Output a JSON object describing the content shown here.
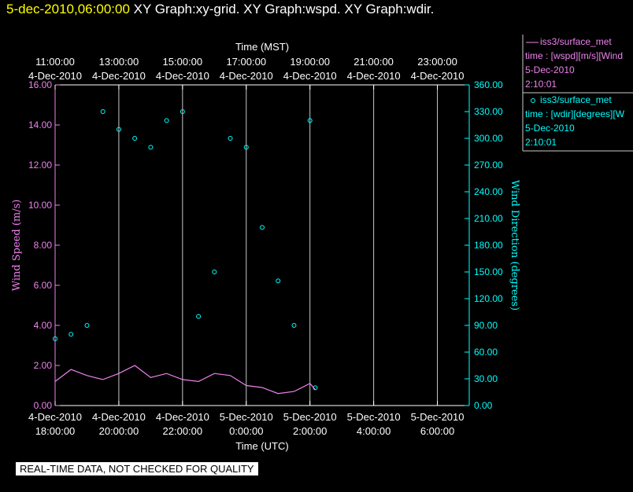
{
  "title": {
    "date": "5-dec-2010,06:00:00",
    "graphs": "XY Graph:xy-grid.  XY Graph:wspd.  XY Graph:wdir."
  },
  "legend": [
    {
      "line_label": "iss3/surface_met",
      "variable": "time : [wspd][m/s][Wind",
      "date": "5-Dec-2010",
      "time": "2:10:01",
      "color": "#ee82ee",
      "marker": "line"
    },
    {
      "line_label": "iss3/surface_met",
      "variable": "time : [wdir][degrees][W",
      "date": "5-Dec-2010",
      "time": "2:10:01",
      "color": "#00ffff",
      "marker": "circle"
    }
  ],
  "qc_banner": "REAL-TIME DATA, NOT CHECKED FOR QUALITY",
  "colors": {
    "background": "#000000",
    "axis": "#ffffff",
    "wind_speed": "#ee82ee",
    "wind_direction": "#00ffff",
    "title_date": "#ffff00"
  },
  "chart_data": {
    "type": "scatter",
    "top_axis": {
      "label": "Time (MST)",
      "ticks": [
        {
          "time": "11:00:00",
          "date": "4-Dec-2010"
        },
        {
          "time": "13:00:00",
          "date": "4-Dec-2010"
        },
        {
          "time": "15:00:00",
          "date": "4-Dec-2010"
        },
        {
          "time": "17:00:00",
          "date": "4-Dec-2010"
        },
        {
          "time": "19:00:00",
          "date": "4-Dec-2010"
        },
        {
          "time": "21:00:00",
          "date": "4-Dec-2010"
        },
        {
          "time": "23:00:00",
          "date": "4-Dec-2010"
        }
      ]
    },
    "bottom_axis": {
      "label": "Time (UTC)",
      "ticks": [
        {
          "date": "4-Dec-2010",
          "time": "18:00:00"
        },
        {
          "date": "4-Dec-2010",
          "time": "20:00:00"
        },
        {
          "date": "4-Dec-2010",
          "time": "22:00:00"
        },
        {
          "date": "5-Dec-2010",
          "time": "0:00:00"
        },
        {
          "date": "5-Dec-2010",
          "time": "2:00:00"
        },
        {
          "date": "5-Dec-2010",
          "time": "4:00:00"
        },
        {
          "date": "5-Dec-2010",
          "time": "6:00:00"
        }
      ],
      "range_hours_utc": [
        "2010-12-04 18:00",
        "2010-12-05 07:00"
      ]
    },
    "left_axis": {
      "label": "Wind Speed (m/s)",
      "range": [
        0,
        16
      ],
      "ticks": [
        "0.00",
        "2.00",
        "4.00",
        "6.00",
        "8.00",
        "10.00",
        "12.00",
        "14.00",
        "16.00"
      ]
    },
    "right_axis": {
      "label": "Wind Direction (degrees)",
      "range": [
        0,
        360
      ],
      "ticks": [
        "0.00",
        "30.00",
        "60.00",
        "90.00",
        "120.00",
        "150.00",
        "180.00",
        "210.00",
        "240.00",
        "270.00",
        "300.00",
        "330.00",
        "360.00"
      ]
    },
    "grid": "vertical",
    "series": [
      {
        "name": "iss3/surface_met wspd",
        "axis": "left",
        "style": "line",
        "x_utc": [
          "2010-12-04 18:00",
          "2010-12-04 18:30",
          "2010-12-04 19:00",
          "2010-12-04 19:30",
          "2010-12-04 20:00",
          "2010-12-04 20:30",
          "2010-12-04 21:00",
          "2010-12-04 21:30",
          "2010-12-04 22:00",
          "2010-12-04 22:30",
          "2010-12-04 23:00",
          "2010-12-04 23:30",
          "2010-12-05 00:00",
          "2010-12-05 00:30",
          "2010-12-05 01:00",
          "2010-12-05 01:30",
          "2010-12-05 02:00",
          "2010-12-05 02:10"
        ],
        "y": [
          1.2,
          1.8,
          1.5,
          1.3,
          1.6,
          2.0,
          1.4,
          1.6,
          1.3,
          1.2,
          1.6,
          1.5,
          1.0,
          0.9,
          0.6,
          0.7,
          1.1,
          0.8
        ]
      },
      {
        "name": "iss3/surface_met wdir",
        "axis": "right",
        "style": "circle",
        "x_utc": [
          "2010-12-04 18:00",
          "2010-12-04 18:30",
          "2010-12-04 19:00",
          "2010-12-04 19:30",
          "2010-12-04 20:00",
          "2010-12-04 20:30",
          "2010-12-04 21:00",
          "2010-12-04 21:30",
          "2010-12-04 22:00",
          "2010-12-04 22:30",
          "2010-12-04 23:00",
          "2010-12-04 23:30",
          "2010-12-05 00:00",
          "2010-12-05 00:30",
          "2010-12-05 01:00",
          "2010-12-05 01:30",
          "2010-12-05 02:00",
          "2010-12-05 02:10"
        ],
        "y": [
          75,
          80,
          90,
          330,
          310,
          300,
          290,
          320,
          330,
          100,
          150,
          300,
          290,
          200,
          140,
          90,
          320,
          20
        ]
      }
    ]
  }
}
